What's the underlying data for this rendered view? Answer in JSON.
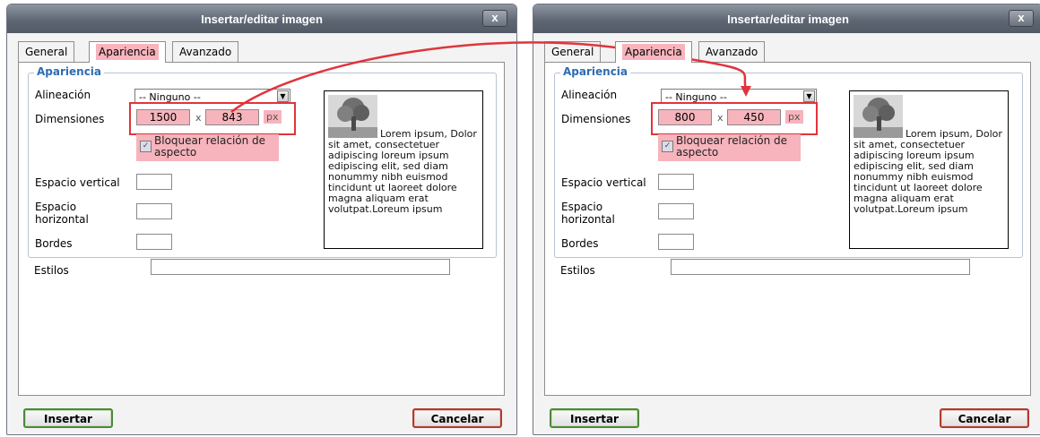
{
  "dialogs": [
    {
      "title": "Insertar/editar imagen",
      "close_label": "x",
      "tabs": [
        "General",
        "Apariencia",
        "Avanzado"
      ],
      "legend": "Apariencia",
      "labels": {
        "alignment": "Alineación",
        "dimensions": "Dimensiones",
        "vspace": "Espacio vertical",
        "hspace_1": "Espacio",
        "hspace_2": "horizontal",
        "borders": "Bordes",
        "styles": "Estilos"
      },
      "alignment_value": "-- Ninguno --",
      "width": "1500",
      "height": "843",
      "times": "x",
      "unit": "px",
      "lock_label_1": "Bloquear relación de",
      "lock_label_2": "aspecto",
      "lock_checked": true,
      "preview_text_first": "Lorem ipsum,",
      "preview_text_rest": "Dolor sit amet, consectetuer adipiscing loreum ipsum edipiscing elit, sed diam nonummy nibh euismod tincidunt ut laoreet dolore magna aliquam erat volutpat.Loreum ipsum",
      "insert_label": "Insertar",
      "cancel_label": "Cancelar"
    },
    {
      "title": "Insertar/editar imagen",
      "close_label": "x",
      "tabs": [
        "General",
        "Apariencia",
        "Avanzado"
      ],
      "legend": "Apariencia",
      "labels": {
        "alignment": "Alineación",
        "dimensions": "Dimensiones",
        "vspace": "Espacio vertical",
        "hspace_1": "Espacio",
        "hspace_2": "horizontal",
        "borders": "Bordes",
        "styles": "Estilos"
      },
      "alignment_value": "-- Ninguno --",
      "width": "800",
      "height": "450",
      "times": "x",
      "unit": "px",
      "lock_label_1": "Bloquear relación de",
      "lock_label_2": "aspecto",
      "lock_checked": true,
      "preview_text_first": "Lorem ipsum,",
      "preview_text_rest": "Dolor sit amet, consectetuer adipiscing loreum ipsum edipiscing elit, sed diam nonummy nibh euismod tincidunt ut laoreet dolore magna aliquam erat volutpat.Loreum ipsum",
      "insert_label": "Insertar",
      "cancel_label": "Cancelar"
    }
  ],
  "colors": {
    "highlight": "#f7b4bc",
    "annotation": "#e0343c",
    "legend": "#2c6cb4"
  }
}
